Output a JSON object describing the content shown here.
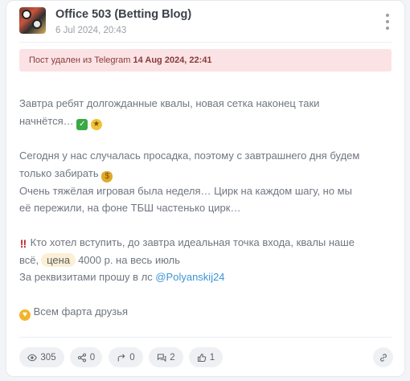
{
  "post": {
    "channel_title": "Office 503 (Betting Blog)",
    "date": "6 Jul 2024, 20:43",
    "deleted_notice_prefix": "Пост удален из Telegram",
    "deleted_date": "14 Aug 2024, 22:41"
  },
  "content": {
    "p1_line1": "Завтра ребят долгожданные квалы, новая сетка наконец таки",
    "p1_line2": "начнётся…",
    "p2_line1": "Сегодня у нас случалась просадка, поэтому с завтрашнего дня будем",
    "p2_line2": "только забирать",
    "p3_line1": "Очень тяжёлая игровая была неделя… Цирк на каждом шагу, но мы",
    "p3_line2": "её пережили, на фоне ТБШ частенько цирк…",
    "p4_line1": "Кто хотел вступить, до завтра идеальная точка входа, квалы наше",
    "p4_line2_before": "всё,",
    "p4_tag": "цена",
    "p4_line2_after": "4000 р. на весь июль",
    "p5_before": "За реквизитами прошу в лс",
    "p5_link": "@Polyanskij24",
    "p6": "Всем фарта друзья"
  },
  "stats": {
    "views": "305",
    "shares": "0",
    "forwards": "0",
    "comments": "2",
    "reactions": "1"
  },
  "icons": [
    "eye-icon",
    "share-icon",
    "forward-icon",
    "comments-icon",
    "thumbs-up-icon",
    "link-icon",
    "more-vertical-icon"
  ],
  "colors": {
    "alert_bg": "#fbe3e5",
    "link": "#3b95d4",
    "tag_bg": "#fcefd4"
  }
}
